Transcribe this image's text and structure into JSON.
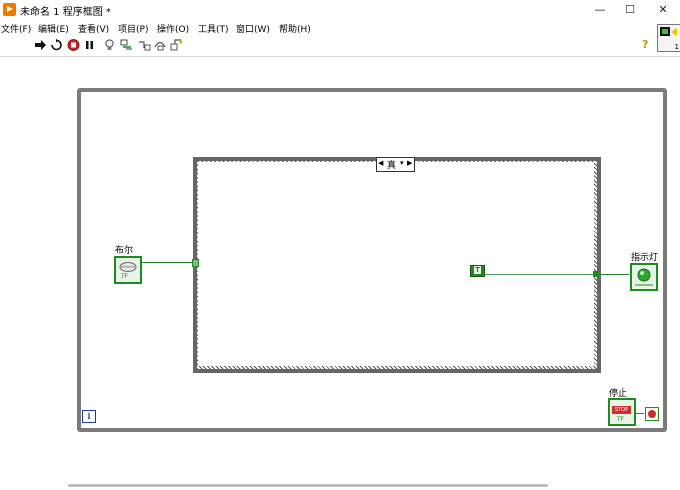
{
  "window": {
    "title": "未命名 1 程序框图 *",
    "minimize": "—",
    "maximize": "☐",
    "close": "✕"
  },
  "menu": [
    "文件(F)",
    "编辑(E)",
    "查看(V)",
    "项目(P)",
    "操作(O)",
    "工具(T)",
    "窗口(W)",
    "帮助(H)"
  ],
  "toolbar": {
    "icons": [
      "run-arrow-icon",
      "run-continuously-icon",
      "abort-icon",
      "pause-icon",
      "highlight-execution-icon",
      "retain-wire-values-icon",
      "step-into-icon",
      "step-over-icon",
      "step-out-icon"
    ],
    "help": "?"
  },
  "connector_pane": {
    "label": "1"
  },
  "diagram": {
    "case_selector": "真",
    "bool_control_label": "布尔",
    "bool_constant": "T",
    "indicator_label": "指示灯",
    "stop_label": "停止",
    "stop_text": "STOP",
    "tf_text": "TF",
    "iteration_terminal": "i"
  },
  "colors": {
    "wire": "#2a7d2a",
    "loop_border": "#7b7b7b",
    "accent": "#f07a00"
  }
}
